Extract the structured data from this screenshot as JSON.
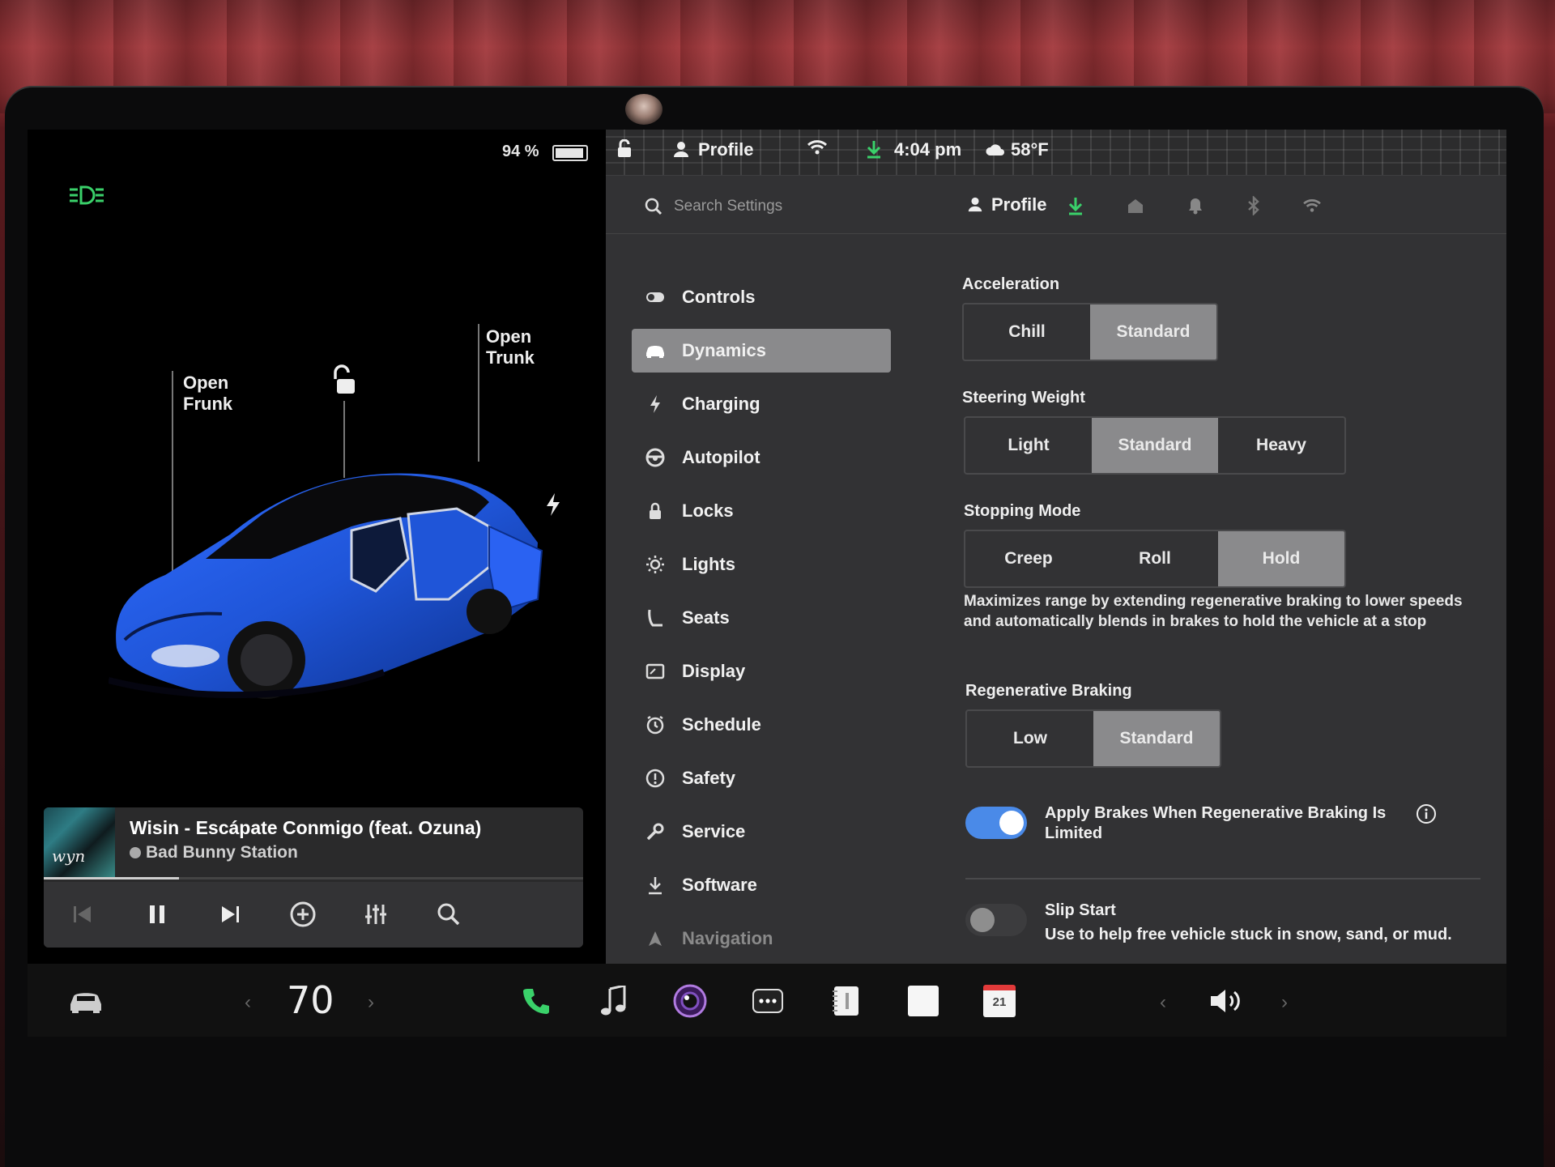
{
  "status_bar": {
    "battery_percent": "94 %",
    "battery_level": 0.94,
    "profile": "Profile",
    "time": "4:04 pm",
    "temperature": "58°F"
  },
  "car_panel": {
    "frunk_label": "Open\nFrunk",
    "trunk_label": "Open\nTrunk",
    "car_color": "#1f55d8"
  },
  "media": {
    "album_art_text": "wyn",
    "track_title": "Wisin - Escápate Conmigo (feat. Ozuna)",
    "station": "Bad Bunny Station",
    "progress": 0.25,
    "controls": [
      "previous-icon",
      "pause-icon",
      "next-icon",
      "add-icon",
      "equalizer-icon",
      "search-icon"
    ]
  },
  "settings": {
    "search_placeholder": "Search Settings",
    "header_profile": "Profile",
    "accent_green": "#3ad16a",
    "accent_blue": "#4a8ae8",
    "menu": [
      {
        "label": "Controls",
        "icon": "toggle-icon"
      },
      {
        "label": "Dynamics",
        "icon": "car-icon",
        "active": true
      },
      {
        "label": "Charging",
        "icon": "bolt-icon"
      },
      {
        "label": "Autopilot",
        "icon": "steering-wheel-icon"
      },
      {
        "label": "Locks",
        "icon": "lock-icon"
      },
      {
        "label": "Lights",
        "icon": "sun-icon"
      },
      {
        "label": "Seats",
        "icon": "seat-icon"
      },
      {
        "label": "Display",
        "icon": "display-icon"
      },
      {
        "label": "Schedule",
        "icon": "alarm-clock-icon"
      },
      {
        "label": "Safety",
        "icon": "alert-circle-icon"
      },
      {
        "label": "Service",
        "icon": "wrench-icon"
      },
      {
        "label": "Software",
        "icon": "download-icon"
      },
      {
        "label": "Navigation",
        "icon": "navigation-arrow-icon"
      }
    ],
    "acceleration": {
      "label": "Acceleration",
      "options": [
        "Chill",
        "Standard"
      ],
      "selected": "Standard"
    },
    "steering_weight": {
      "label": "Steering Weight",
      "options": [
        "Light",
        "Standard",
        "Heavy"
      ],
      "selected": "Standard"
    },
    "stopping_mode": {
      "label": "Stopping Mode",
      "options": [
        "Creep",
        "Roll",
        "Hold"
      ],
      "selected": "Hold",
      "description": "Maximizes range by extending regenerative braking to lower speeds and automatically blends in brakes to hold the vehicle at a stop"
    },
    "regen_braking": {
      "label": "Regenerative Braking",
      "options": [
        "Low",
        "Standard"
      ],
      "selected": "Standard"
    },
    "apply_brakes": {
      "label": "Apply Brakes When Regenerative Braking Is Limited",
      "enabled": true
    },
    "slip_start": {
      "label": "Slip Start",
      "description": "Use to help free vehicle stuck in snow, sand, or mud.",
      "enabled": false
    }
  },
  "dock": {
    "temperature": "70",
    "calendar_day": "21",
    "items": [
      "car-icon",
      "phone-icon",
      "music-note-icon",
      "camera-icon",
      "more-icon",
      "notes-icon",
      "blank-app-icon",
      "calendar-icon",
      "volume-icon"
    ]
  }
}
